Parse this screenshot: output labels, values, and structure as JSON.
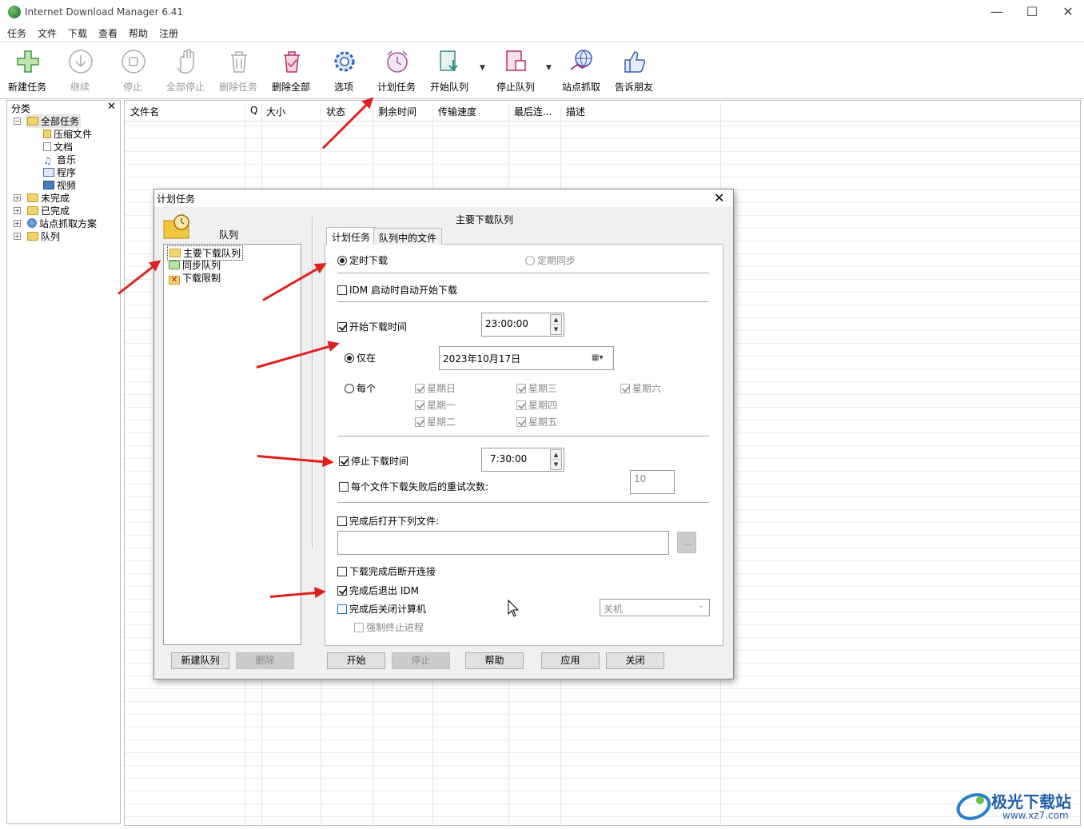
{
  "app": {
    "title": "Internet Download Manager 6.41"
  },
  "menu": [
    "任务",
    "文件",
    "下载",
    "查看",
    "帮助",
    "注册"
  ],
  "toolbar": [
    {
      "label": "新建任务",
      "icon": "plus-icon"
    },
    {
      "label": "继续",
      "icon": "download-arrow-icon"
    },
    {
      "label": "停止",
      "icon": "stop-icon"
    },
    {
      "label": "全部停止",
      "icon": "hand-icon"
    },
    {
      "label": "删除任务",
      "icon": "trash-icon"
    },
    {
      "label": "删除全部",
      "icon": "trash-all-icon"
    },
    {
      "label": "选项",
      "icon": "gear-icon"
    },
    {
      "label": "计划任务",
      "icon": "alarm-clock-icon"
    },
    {
      "label": "开始队列",
      "icon": "queue-start-icon"
    },
    {
      "label": "停止队列",
      "icon": "queue-stop-icon"
    },
    {
      "label": "站点抓取",
      "icon": "globe-grab-icon"
    },
    {
      "label": "告诉朋友",
      "icon": "thumbs-up-icon"
    }
  ],
  "sidebar": {
    "title": "分类",
    "tree": [
      {
        "label": "全部任务",
        "children": [
          "压缩文件",
          "文档",
          "音乐",
          "程序",
          "视频"
        ]
      },
      {
        "label": "未完成"
      },
      {
        "label": "已完成"
      },
      {
        "label": "站点抓取方案"
      },
      {
        "label": "队列"
      }
    ]
  },
  "columns": [
    "文件名",
    "Q",
    "大小",
    "状态",
    "剩余时间",
    "传输速度",
    "最后连...",
    "描述"
  ],
  "dialog": {
    "title": "计划任务",
    "queue_header": "队列",
    "queues": [
      "主要下载队列",
      "同步队列",
      "下载限制"
    ],
    "panel_title": "主要下载队列",
    "tabs": [
      "计划任务",
      "队列中的文件"
    ],
    "radio_timed": "定时下载",
    "radio_sync": "定期同步",
    "auto_start": "IDM 启动时自动开始下载",
    "start_time_label": "开始下载时间",
    "start_time": "23:00:00",
    "only_on": "仅在",
    "date": "2023年10月17日",
    "every": "每个",
    "days": [
      "星期日",
      "星期一",
      "星期二",
      "星期三",
      "星期四",
      "星期五",
      "星期六"
    ],
    "stop_time_label": "停止下载时间",
    "stop_time": "7:30:00",
    "retry_label": "每个文件下载失败后的重试次数:",
    "retry_value": "10",
    "open_after_label": "完成后打开下列文件:",
    "browse_label": "...",
    "disconnect_label": "下载完成后断开连接",
    "exit_idm_label": "完成后退出 IDM",
    "shutdown_label": "完成后关闭计算机",
    "shutdown_option": "关机",
    "force_kill_label": "强制终止进程",
    "buttons": {
      "new_queue": "新建队列",
      "delete": "删除",
      "start": "开始",
      "stop": "停止",
      "help": "帮助",
      "apply": "应用",
      "close": "关闭"
    }
  },
  "watermark": {
    "brand": "极光下载站",
    "url": "www.xz7.com"
  },
  "colors": {
    "arrow": "#e01f1f",
    "accent": "#1a73c9"
  }
}
